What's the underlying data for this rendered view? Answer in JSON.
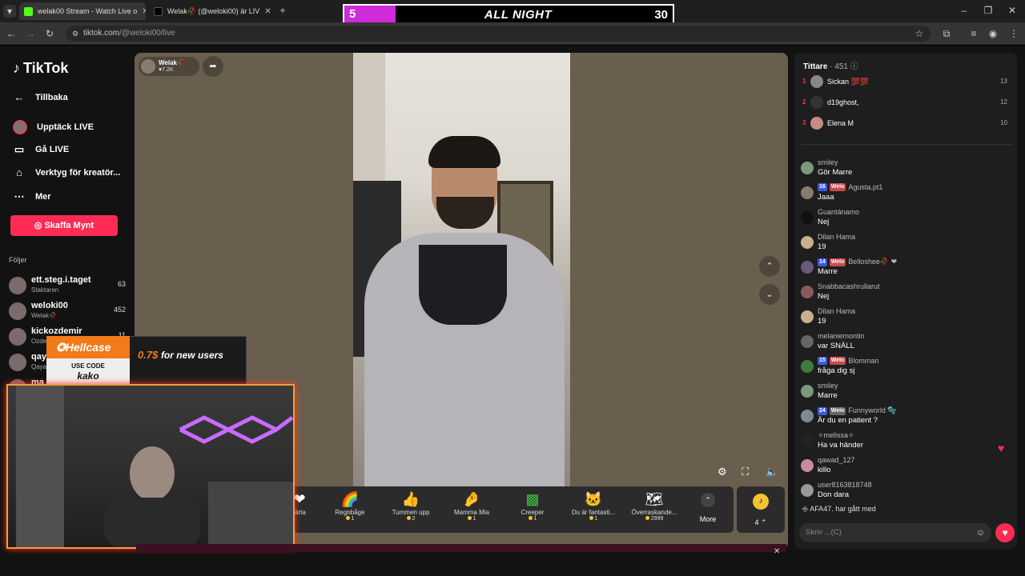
{
  "browser": {
    "tabs": [
      {
        "title": "welak00 Stream - Watch Live o",
        "color": "#53fc18"
      },
      {
        "title": "Welak🥀 (@weloki00) är LIV",
        "color": "#000000"
      }
    ],
    "url_host": "tiktok.com",
    "url_path": "/@weloki00/live"
  },
  "overlay_banner": {
    "left": "5",
    "title": "ALL NIGHT",
    "right": "30"
  },
  "sidebar": {
    "logo": "TikTok",
    "back": "Tillbaka",
    "nav": [
      {
        "label": "Upptäck LIVE",
        "icon": "avatar-icon"
      },
      {
        "label": "Gå LIVE",
        "icon": "camera-icon"
      },
      {
        "label": "Verktyg för kreatör...",
        "icon": "creator-tools-icon"
      },
      {
        "label": "Mer",
        "icon": "more-icon"
      }
    ],
    "coins_button": "Skaffa Mynt",
    "following_heading": "Följer",
    "following": [
      {
        "name": "ett.steg.i.taget",
        "sub": "Staktaren",
        "count": "63"
      },
      {
        "name": "weloki00",
        "sub": "Welak🥀",
        "count": "452"
      },
      {
        "name": "kickozdemir",
        "sub": "Ozde",
        "count": "11"
      },
      {
        "name": "qay",
        "sub": "Qaya",
        "count": ""
      },
      {
        "name": "ma",
        "sub": "",
        "count": ""
      }
    ]
  },
  "host": {
    "name": "Welak🥀",
    "likes": "7.2K"
  },
  "gifts": [
    {
      "name": "järta",
      "price": "",
      "icon": "❤"
    },
    {
      "name": "Regnbåge",
      "price": "1",
      "icon": "🌈"
    },
    {
      "name": "Tummen upp",
      "price": "2",
      "icon": "👍"
    },
    {
      "name": "Mamma Mia",
      "price": "1",
      "icon": "🤌"
    },
    {
      "name": "Creeper",
      "price": "1",
      "icon": "▩"
    },
    {
      "name": "Du är fantasti...",
      "price": "1",
      "icon": "🐱"
    },
    {
      "name": "Överraskande...",
      "price": "2999",
      "icon": "🗺"
    }
  ],
  "gift_more": "More",
  "coin_balance": "4",
  "chat": {
    "viewers_label": "Tittare",
    "viewers_count": "451",
    "top": [
      {
        "rank": "1",
        "name": "Sickan 💯💯",
        "score": "13"
      },
      {
        "rank": "2",
        "name": "d19ghost,",
        "score": "12"
      },
      {
        "rank": "3",
        "name": "Elena M",
        "score": "10"
      }
    ],
    "messages": [
      {
        "user": "smiley",
        "text": "Gör Marre",
        "level": "",
        "club": ""
      },
      {
        "user": "Agusta.pt1",
        "text": "Jaaa",
        "level": "16",
        "club": "Welo"
      },
      {
        "user": "Guantánamo",
        "text": "Nej",
        "level": "",
        "club": ""
      },
      {
        "user": "Dilan Hama",
        "text": "19",
        "level": "",
        "club": ""
      },
      {
        "user": "Belloshee🥀 ❤",
        "text": "Marre",
        "level": "14",
        "club": "Welo"
      },
      {
        "user": "Snabbacashrullarut",
        "text": "Nej",
        "level": "",
        "club": ""
      },
      {
        "user": "Dilan Hama",
        "text": "19",
        "level": "",
        "club": ""
      },
      {
        "user": "melaniemontin",
        "text": "var SNÄLL",
        "level": "",
        "club": ""
      },
      {
        "user": "Blomman",
        "text": "fråga dig sj",
        "level": "15",
        "club": "Welo"
      },
      {
        "user": "smiley",
        "text": "Marre",
        "level": "",
        "club": ""
      },
      {
        "user": "Funnyworld 🫧",
        "text": "Är du en patient ?",
        "level": "24",
        "club": "Welo"
      },
      {
        "user": "✧melissa✧",
        "text": "Ha va händer",
        "level": "",
        "club": ""
      },
      {
        "user": "qawad_127",
        "text": "killo",
        "level": "",
        "club": ""
      },
      {
        "user": "user8163818748",
        "text": "Don dara",
        "level": "",
        "club": ""
      }
    ],
    "join_notice": "AFA47. har gått med",
    "input_placeholder": "Skriv ...(C)"
  },
  "hellcase": {
    "brand": "Hellcase",
    "code_label": "USE CODE",
    "code": "kako",
    "promo_amount": "0.7$",
    "promo_text": "for new users"
  }
}
